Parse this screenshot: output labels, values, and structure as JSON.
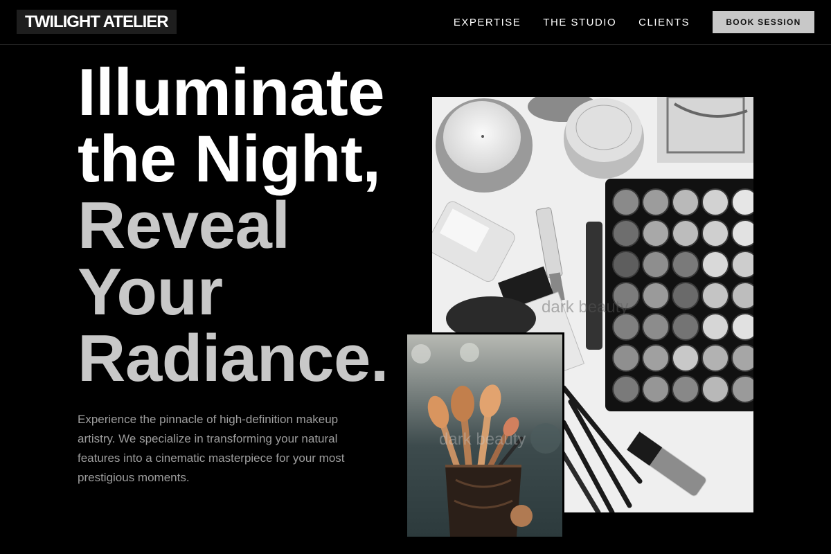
{
  "brand": {
    "name": "TWILIGHT ATELIER"
  },
  "nav": {
    "links": [
      "EXPERTISE",
      "THE STUDIO",
      "CLIENTS"
    ],
    "cta": "BOOK SESSION"
  },
  "hero": {
    "headline_white": [
      "Illuminate",
      "the Night,"
    ],
    "headline_grey": [
      "Reveal",
      "Your",
      "Radiance."
    ],
    "lead": "Experience the pinnacle of high-definition makeup artistry. We specialize in transforming your natural features into a cinematic masterpiece for your most prestigious moments."
  },
  "images": {
    "main_watermark": "dark beauty",
    "small_watermark": "dark beauty"
  }
}
